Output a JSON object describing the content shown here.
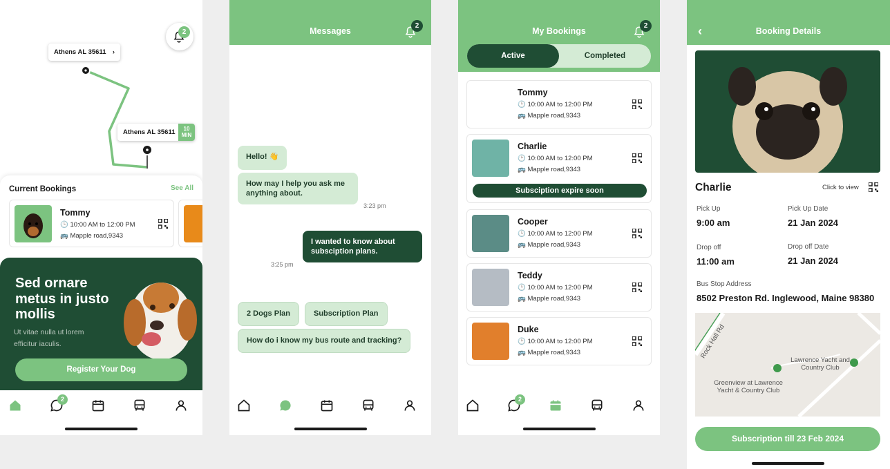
{
  "colors": {
    "primary": "#7cc380",
    "dark": "#1f4d34",
    "light": "#d4ebd5"
  },
  "home": {
    "map": {
      "pin_top_label": "Athens AL 35611",
      "pin_bottom_label": "Athens AL 35611",
      "eta_value": "10",
      "eta_unit": "MIN",
      "notif_count": "2"
    },
    "bookings_title": "Current Bookings",
    "see_all": "See All",
    "card": {
      "name": "Tommy",
      "time": "10:00 AM to 12:00 PM",
      "address": "Mapple road,9343"
    },
    "promo": {
      "heading": "Sed ornare metus in justo mollis",
      "text": "Ut vitae nulla ut lorem efficitur iaculis.",
      "button": "Register Your Dog"
    },
    "messages_badge": "2"
  },
  "messages": {
    "title": "Messages",
    "notif_count": "2",
    "bubbles": [
      {
        "text": "Hello! 👋"
      },
      {
        "text": "How may I help you ask me anything about.",
        "time": "3:23 pm"
      },
      {
        "text": "I wanted to know about subsciption plans.",
        "time": "3:25 pm"
      }
    ],
    "chips": [
      "2 Dogs Plan",
      "Subscription Plan",
      "How do i know my bus route and tracking?"
    ]
  },
  "bookings": {
    "title": "My Bookings",
    "notif_count": "2",
    "tab_active": "Active",
    "tab_completed": "Completed",
    "items": [
      {
        "name": "Tommy",
        "time": "10:00 AM to 12:00 PM",
        "address": "Mapple road,9343"
      },
      {
        "name": "Charlie",
        "time": "10:00 AM to 12:00 PM",
        "address": "Mapple road,9343",
        "notice": "Subsciption expire soon"
      },
      {
        "name": "Cooper",
        "time": "10:00 AM to 12:00 PM",
        "address": "Mapple road,9343"
      },
      {
        "name": "Teddy",
        "time": "10:00 AM to 12:00 PM",
        "address": "Mapple road,9343"
      },
      {
        "name": "Duke",
        "time": "10:00 AM to 12:00 PM",
        "address": "Mapple road,9343"
      }
    ],
    "messages_badge": "2"
  },
  "details": {
    "title": "Booking Details",
    "name": "Charlie",
    "click_to_view": "Click to view",
    "pickup_label": "Pick Up",
    "pickup": "9:00 am",
    "pickup_date_label": "Pick Up Date",
    "pickup_date": "21 Jan 2024",
    "dropoff_label": "Drop off",
    "dropoff": "11:00 am",
    "dropoff_date_label": "Drop off Date",
    "dropoff_date": "21 Jan 2024",
    "address_label": "Bus Stop Address",
    "address": "8502 Preston Rd. Inglewood, Maine 98380",
    "map": {
      "road": "Rock Hall Rd",
      "place1": "Lawrence Yacht and Country Club",
      "place2": "Greenview at Lawrence Yacht & Country Club"
    },
    "button": "Subscription till 23 Feb 2024"
  }
}
